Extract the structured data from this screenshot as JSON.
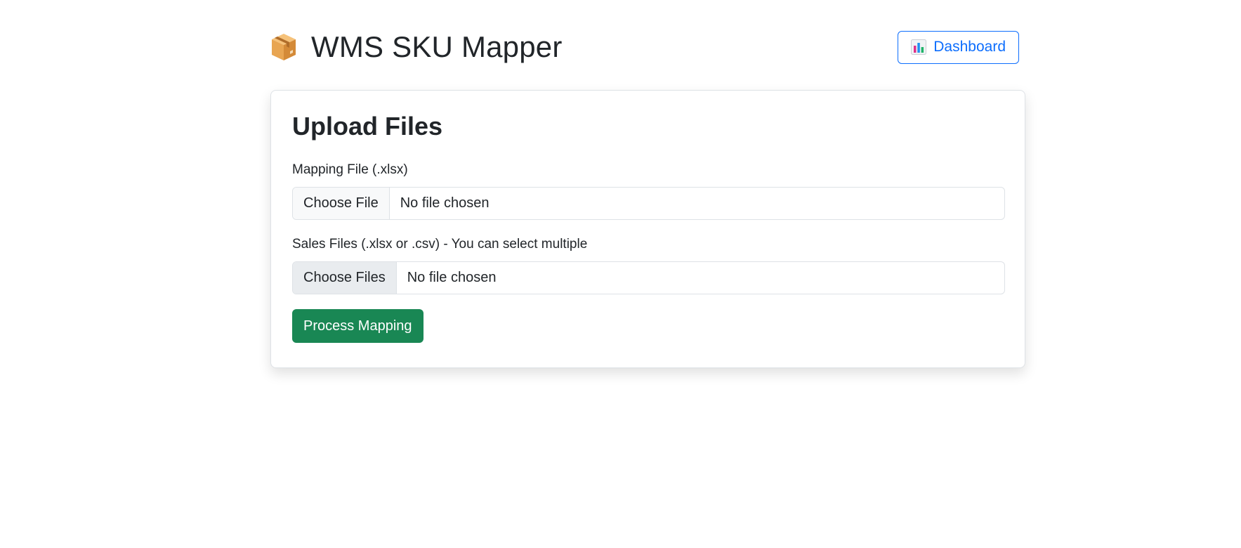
{
  "header": {
    "title": "WMS SKU Mapper",
    "brand_icon": "package-icon",
    "dashboard_label": "Dashboard",
    "dashboard_icon": "bar-chart-icon"
  },
  "upload_card": {
    "title": "Upload Files",
    "mapping_field": {
      "label": "Mapping File (.xlsx)",
      "button_label": "Choose File",
      "status": "No file chosen"
    },
    "sales_field": {
      "label": "Sales Files (.xlsx or .csv) - You can select multiple",
      "button_label": "Choose Files",
      "status": "No file chosen"
    },
    "submit_label": "Process Mapping"
  },
  "colors": {
    "primary": "#0d6efd",
    "success": "#198754",
    "text": "#212529",
    "border": "#dee2e6"
  }
}
